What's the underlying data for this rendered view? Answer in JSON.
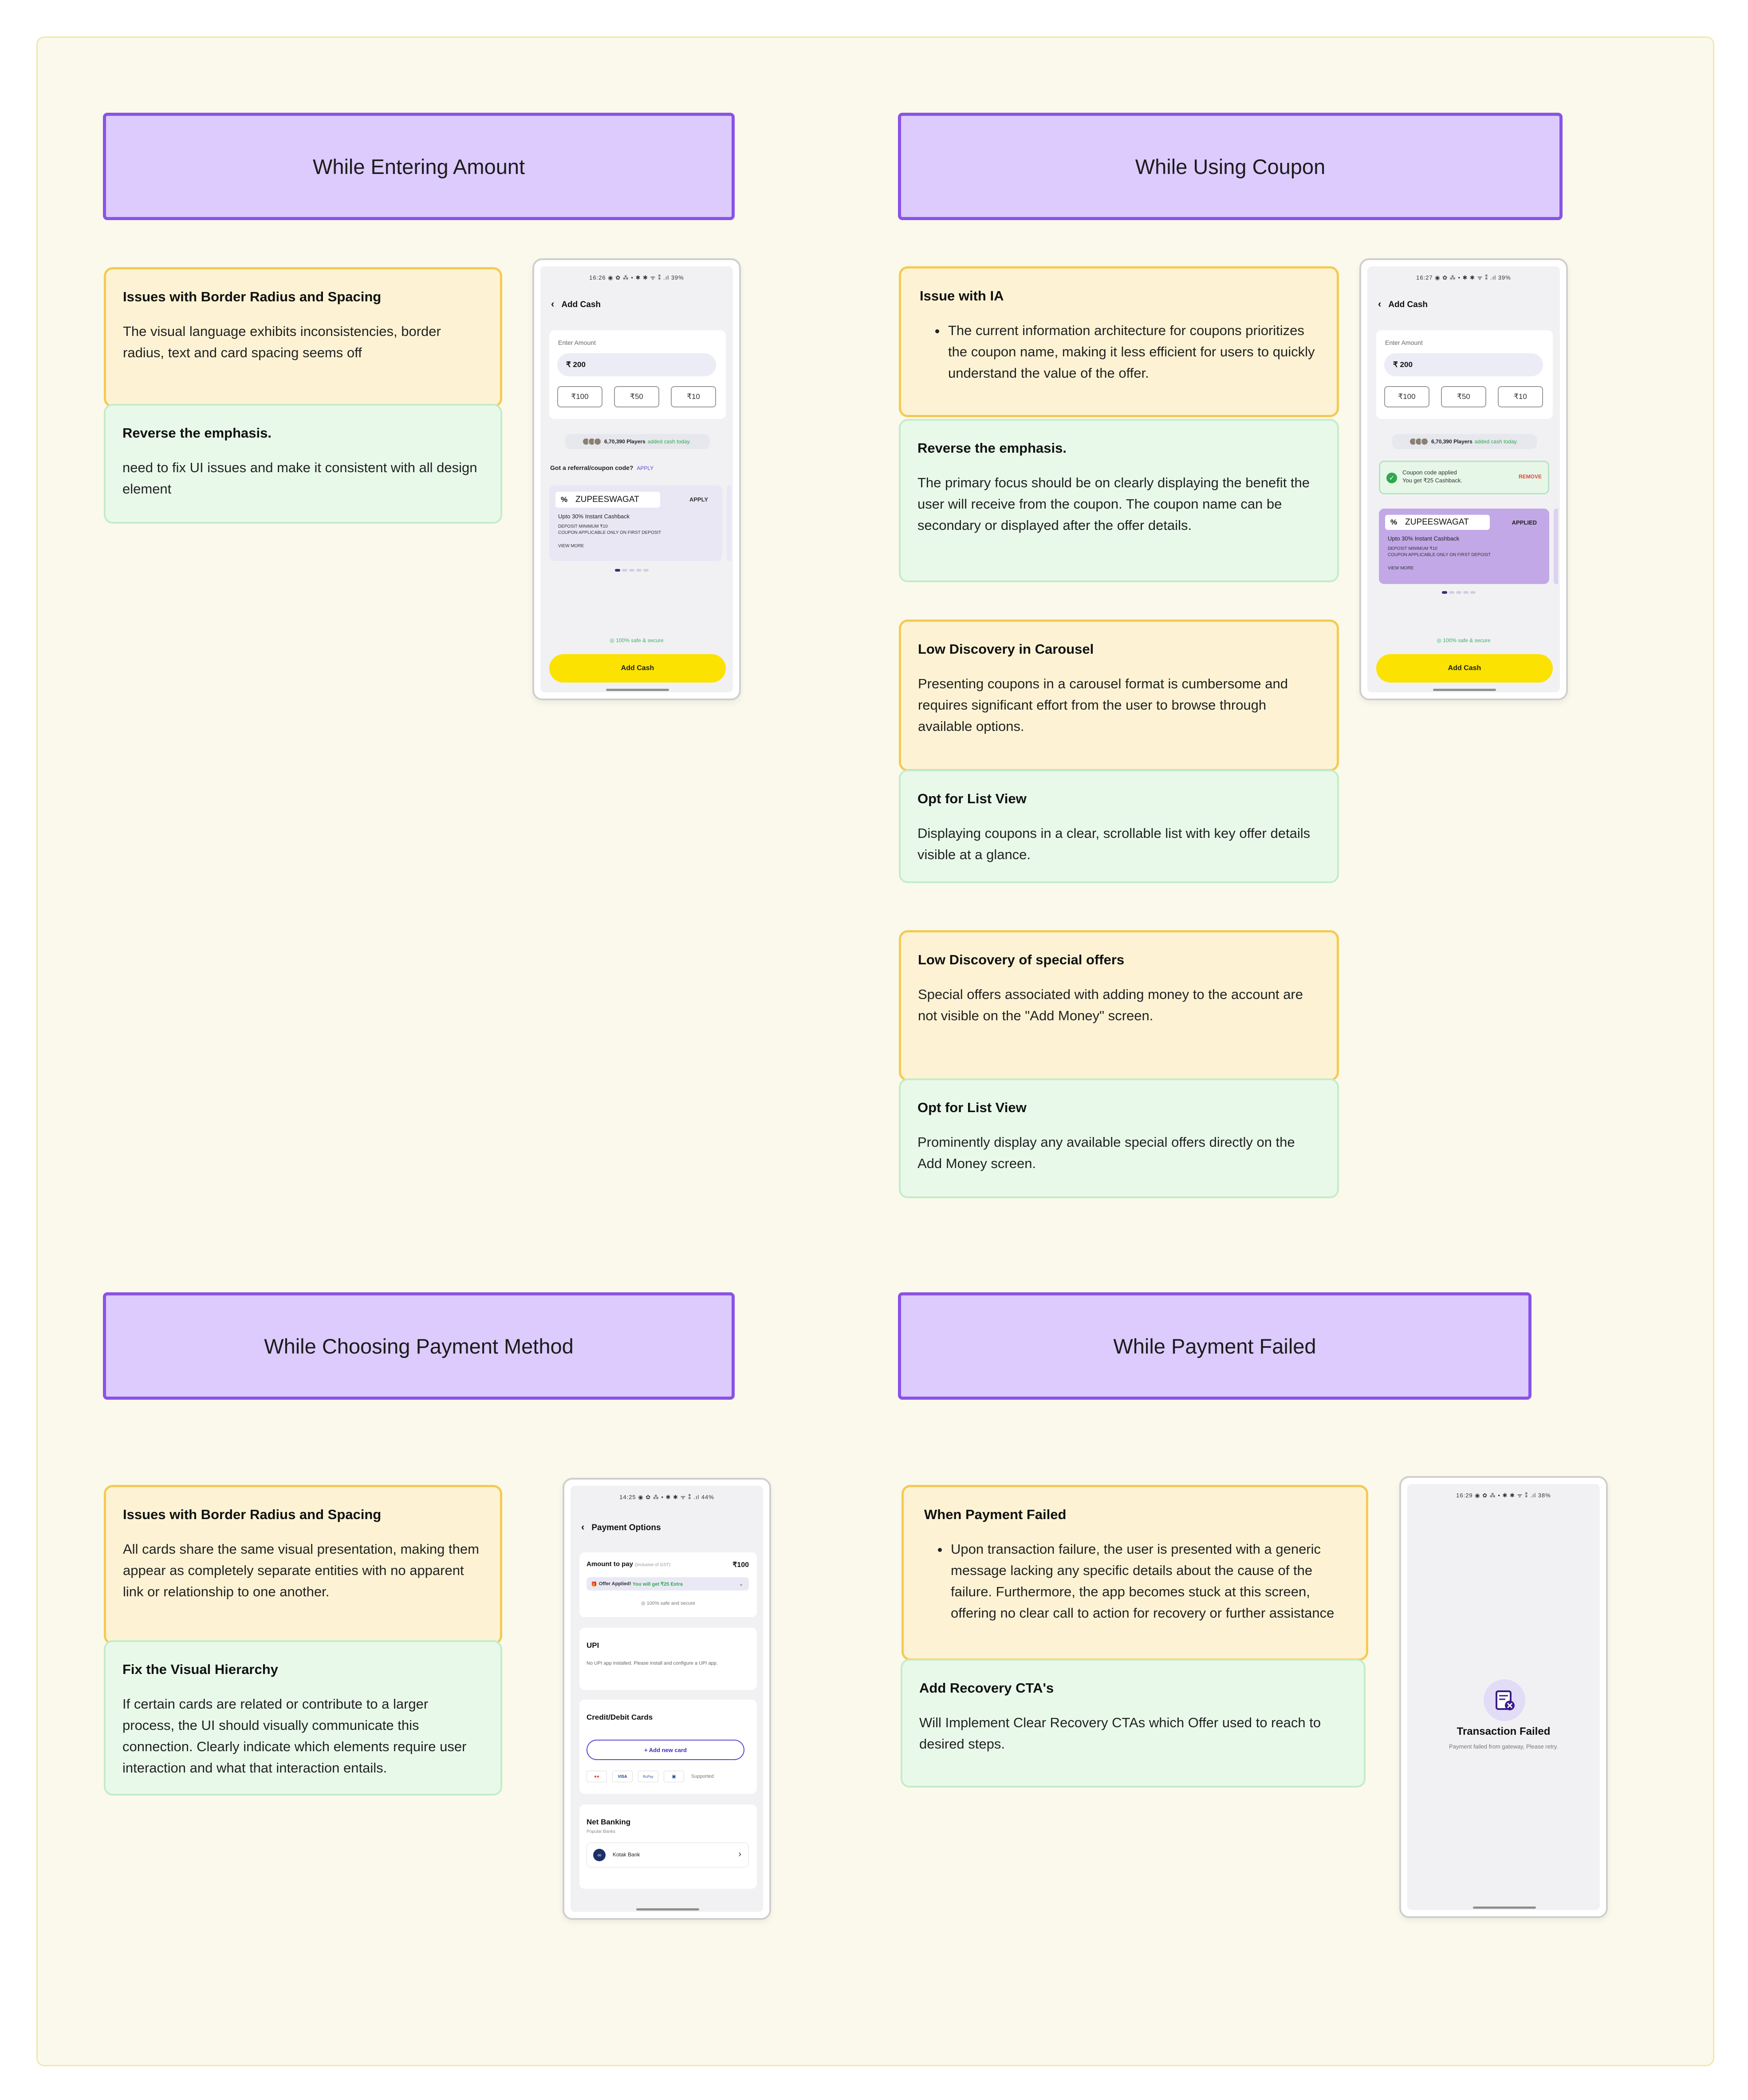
{
  "sections": {
    "entering": {
      "title": "While Entering Amount"
    },
    "coupon": {
      "title": "While Using Coupon"
    },
    "payment": {
      "title": "While Choosing Payment Method"
    },
    "failed": {
      "title": "While Payment Failed"
    }
  },
  "notes": {
    "entering_issue": {
      "heading": "Issues with Border Radius and Spacing",
      "body": "The visual language exhibits inconsistencies, border radius, text and card spacing seems off"
    },
    "entering_fix": {
      "heading": "Reverse the emphasis.",
      "body": "need to fix UI issues and make it consistent with all design element"
    },
    "coupon_ia_issue": {
      "heading": "Issue with IA",
      "bullet": "The current information architecture for coupons prioritizes the coupon name, making it less efficient for users to quickly understand the value of the offer."
    },
    "coupon_ia_fix": {
      "heading": "Reverse the emphasis.",
      "body": "The primary focus should be on clearly displaying the benefit the user will receive from the coupon. The coupon name can be secondary or displayed after the offer details."
    },
    "carousel_issue": {
      "heading": "Low Discovery in Carousel",
      "body": "Presenting coupons in a carousel format is cumbersome and requires significant effort from the user to browse through available options."
    },
    "carousel_fix": {
      "heading": "Opt for List View",
      "body": "Displaying coupons in a clear, scrollable list with key offer details visible at a glance."
    },
    "offers_issue": {
      "heading": "Low Discovery of special offers",
      "body": "Special offers associated with adding money to the account are not visible on the \"Add Money\" screen."
    },
    "offers_fix": {
      "heading": "Opt for List View",
      "body": "Prominently display any available special offers directly on the Add Money screen."
    },
    "payment_issue": {
      "heading": "Issues with Border Radius and Spacing",
      "body": "All cards share the same visual presentation, making them appear as completely separate entities with no apparent link or relationship to one another."
    },
    "payment_fix": {
      "heading": "Fix the Visual Hierarchy",
      "body": "If certain cards are related or contribute to a larger process, the UI should visually communicate this connection. Clearly indicate which elements require user interaction and what that interaction entails."
    },
    "failed_issue": {
      "heading": "When Payment Failed",
      "bullet": "Upon transaction failure, the user is presented with a generic message lacking any specific details about the cause of the failure. Furthermore, the app becomes stuck at this screen, offering no clear call to action for recovery or further assistance"
    },
    "failed_fix": {
      "heading": "Add Recovery CTA's",
      "body": "Will Implement Clear Recovery CTAs which Offer used to reach to desired steps."
    }
  },
  "phone1": {
    "status": "16:26 ◉ ✿ ⁂ • ✱ ✱ ᯤ ⁑ .ıl 39%",
    "title": "Add Cash",
    "amount_label": "Enter Amount",
    "amount": "₹ 200",
    "chips": [
      "₹100",
      "₹50",
      "₹10"
    ],
    "players_count": "6,70,390 Players",
    "players_suffix": "added cash today.",
    "referral_q": "Got a referral/coupon code?",
    "referral_apply": "APPLY",
    "coupon_pct": "%",
    "coupon_code": "ZUPEESWAGAT",
    "coupon_action": "APPLY",
    "coupon_benefit": "Upto 30% Instant Cashback",
    "coupon_deposit": "DEPOSIT MINIMUM ₹10",
    "coupon_note": "COUPON APPLICABLE ONLY ON FIRST DEPOSIT",
    "view_more": "VIEW MORE",
    "safe": "◎ 100% safe & secure",
    "cta": "Add Cash"
  },
  "phone2": {
    "status": "16:27 ◉ ✿ ⁂ • ✱ ✱ ᯤ ⁑ .ıl 39%",
    "title": "Add Cash",
    "amount_label": "Enter Amount",
    "amount": "₹ 200",
    "chips": [
      "₹100",
      "₹50",
      "₹10"
    ],
    "players_count": "6,70,390 Players",
    "players_suffix": "added cash today.",
    "applied_line1": "Coupon code applied",
    "applied_line2": "You get ₹25 Cashback.",
    "remove": "REMOVE",
    "coupon_pct": "%",
    "coupon_code": "ZUPEESWAGAT",
    "coupon_action": "APPLIED",
    "coupon_benefit": "Upto 30% Instant Cashback",
    "coupon_deposit": "DEPOSIT MINIMUM ₹10",
    "coupon_note": "COUPON APPLICABLE ONLY ON FIRST DEPOSIT",
    "view_more": "VIEW MORE",
    "safe": "◎ 100% safe & secure",
    "cta": "Add Cash"
  },
  "phone3": {
    "status": "14:25 ◉ ✿ ⁂ • ✱ ✱ ᯤ ⁑ .ıl 44%",
    "title": "Payment Options",
    "amount_label": "Amount to pay",
    "amount_sub": "(Inclusive of GST)",
    "amount": "₹100",
    "offer_bold": "Offer Applied!",
    "offer_green": "You will get ₹25 Extra",
    "safe": "◎ 100% safe and secure",
    "upi_title": "UPI",
    "upi_text": "No UPI app installed. Please install and configure a UPI app.",
    "cards_title": "Credit/Debit Cards",
    "add_card": "+ Add new card",
    "card_brands": [
      "●●",
      "VISA",
      "RuPay",
      "▣"
    ],
    "supported": "Supported",
    "nb_title": "Net Banking",
    "nb_sub": "Popular Banks",
    "bank": "Kotak Bank"
  },
  "phone4": {
    "status": "16:29 ◉ ✿ ⁂ • ✱ ✱ ᯤ ⁑ .ıl 38%",
    "fail_title": "Transaction Failed",
    "fail_sub": "Payment failed from gateway, Please retry."
  },
  "colors": {
    "header_bg": "#dccbfc",
    "header_border": "#8a53e6",
    "issue_bg": "#fdf3d4",
    "issue_border": "#f5ca52",
    "fix_bg": "#e8f9ea",
    "fix_border": "#c4ecc9",
    "cta_yellow": "#fbe200",
    "coupon_applied_bg": "#c2a8e6"
  }
}
